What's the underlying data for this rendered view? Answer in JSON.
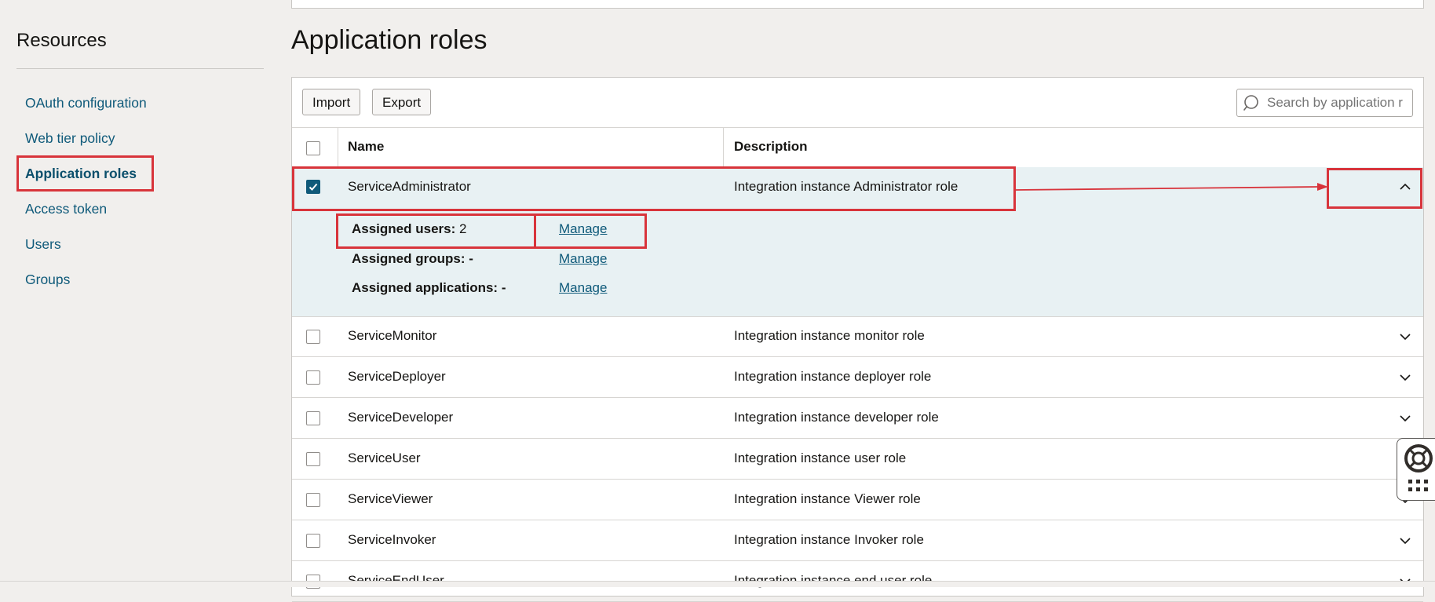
{
  "sidebar": {
    "title": "Resources",
    "items": [
      {
        "label": "OAuth configuration"
      },
      {
        "label": "Web tier policy"
      },
      {
        "label": "Application roles"
      },
      {
        "label": "Access token"
      },
      {
        "label": "Users"
      },
      {
        "label": "Groups"
      }
    ],
    "active_index": 2
  },
  "main": {
    "title": "Application roles",
    "toolbar": {
      "import_label": "Import",
      "export_label": "Export"
    },
    "search": {
      "placeholder": "Search by application r",
      "icon": "search-icon"
    },
    "table": {
      "headers": {
        "name": "Name",
        "description": "Description"
      },
      "rows": [
        {
          "name": "ServiceAdministrator",
          "description": "Integration instance Administrator role",
          "checked": true,
          "expanded": true
        },
        {
          "name": "ServiceMonitor",
          "description": "Integration instance monitor role",
          "checked": false,
          "expanded": false
        },
        {
          "name": "ServiceDeployer",
          "description": "Integration instance deployer role",
          "checked": false,
          "expanded": false
        },
        {
          "name": "ServiceDeveloper",
          "description": "Integration instance developer role",
          "checked": false,
          "expanded": false
        },
        {
          "name": "ServiceUser",
          "description": "Integration instance user role",
          "checked": false,
          "expanded": false
        },
        {
          "name": "ServiceViewer",
          "description": "Integration instance Viewer role",
          "checked": false,
          "expanded": false
        },
        {
          "name": "ServiceInvoker",
          "description": "Integration instance Invoker role",
          "checked": false,
          "expanded": false
        },
        {
          "name": "ServiceEndUser",
          "description": "Integration instance end user role",
          "checked": false,
          "expanded": false
        }
      ],
      "detail": {
        "users_label": "Assigned users:",
        "users_value": "2",
        "groups_label": "Assigned groups:",
        "groups_value": "-",
        "apps_label": "Assigned applications:",
        "apps_value": "-",
        "manage_label": "Manage"
      }
    }
  },
  "colors": {
    "accent": "#0f5a7a",
    "highlight": "#d8343b",
    "expanded_bg": "#e8f1f3"
  },
  "icons": [
    "search-icon",
    "checkmark-icon",
    "chevron-up-icon",
    "chevron-down-icon",
    "lifebuoy-icon",
    "grid-icon"
  ]
}
